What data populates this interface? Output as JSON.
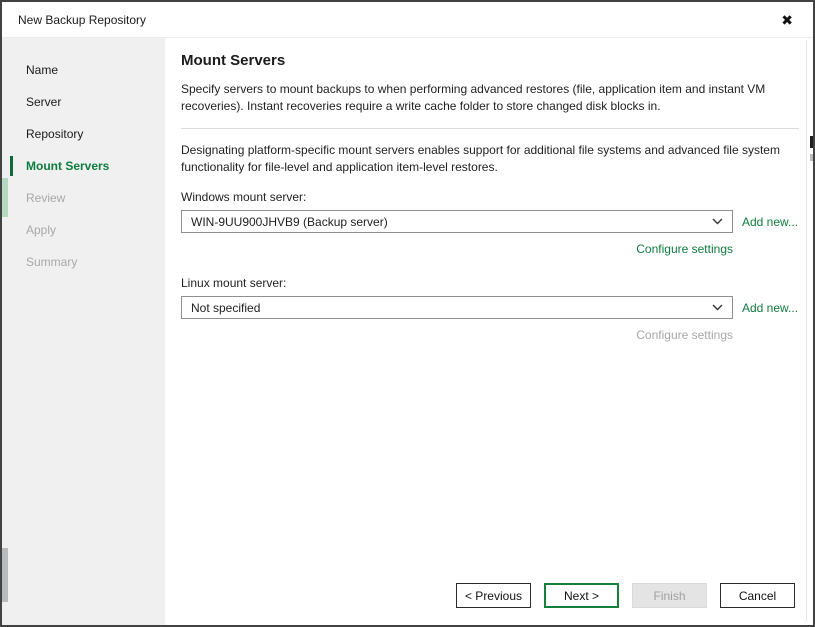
{
  "window": {
    "title": "New Backup Repository",
    "close_icon": "✖"
  },
  "accent_color": "#0f7c3f",
  "sidebar": {
    "items": [
      {
        "label": "Name",
        "state": "enabled"
      },
      {
        "label": "Server",
        "state": "enabled"
      },
      {
        "label": "Repository",
        "state": "enabled"
      },
      {
        "label": "Mount Servers",
        "state": "active"
      },
      {
        "label": "Review",
        "state": "disabled"
      },
      {
        "label": "Apply",
        "state": "disabled"
      },
      {
        "label": "Summary",
        "state": "disabled"
      }
    ]
  },
  "main": {
    "heading": "Mount Servers",
    "description": "Specify servers to mount backups to when performing advanced restores (file, application item and instant VM recoveries). Instant recoveries require a write cache folder to store changed disk blocks in.",
    "info": "Designating platform-specific mount servers enables support for additional file systems and advanced file system functionality for file-level and application item-level restores.",
    "windows_section": {
      "label": "Windows mount server:",
      "value": "WIN-9UU900JHVB9 (Backup server)",
      "add_new_label": "Add new...",
      "configure_label": "Configure settings"
    },
    "linux_section": {
      "label": "Linux mount server:",
      "value": "Not specified",
      "add_new_label": "Add new...",
      "configure_label": "Configure settings"
    }
  },
  "footer": {
    "previous_label": "< Previous",
    "next_label": "Next >",
    "finish_label": "Finish",
    "cancel_label": "Cancel"
  }
}
